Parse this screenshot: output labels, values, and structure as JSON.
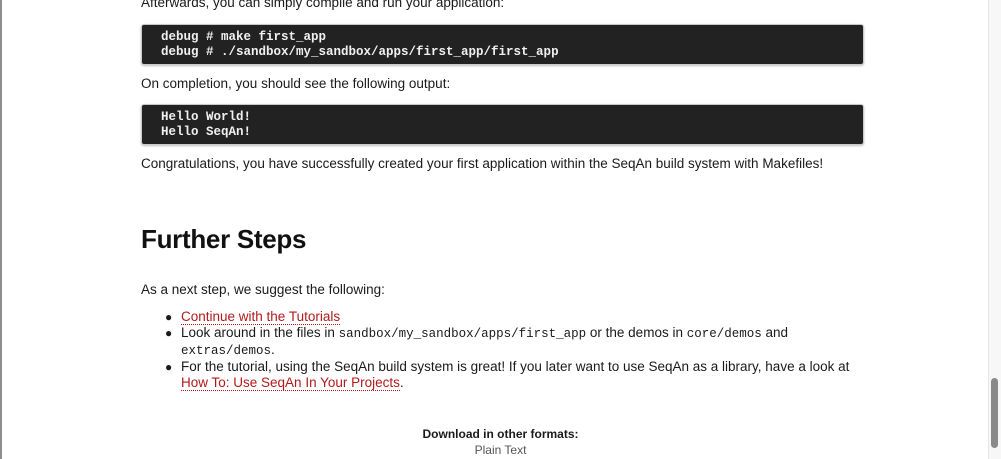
{
  "intro_text": "Afterwards, you can simply compile and run your application:",
  "code_build": {
    "lines": [
      "debug # make first_app",
      "debug # ./sandbox/my_sandbox/apps/first_app/first_app"
    ]
  },
  "completion_text": "On completion, you should see the following output:",
  "code_output": {
    "lines": [
      "Hello World!",
      "Hello SeqAn!"
    ]
  },
  "congrats_text": "Congratulations, you have successfully created your first application within the SeqAn build system with Makefiles!",
  "further_steps": {
    "heading": "Further Steps",
    "intro": "As a next step, we suggest the following:",
    "item1_link": "Continue with the Tutorials",
    "item2": {
      "part1": "Look around in the files in ",
      "code1": "sandbox/my_sandbox/apps/first_app",
      "part2": " or the demos in ",
      "code2": "core/demos",
      "part3": " and ",
      "code3": "extras/demos",
      "part4": "."
    },
    "item3": {
      "part1": "For the tutorial, using the SeqAn build system is great! If you later want to use SeqAn as a library, have a look at ",
      "link": "How To: Use SeqAn In Your Projects",
      "part2": "."
    }
  },
  "downloads": {
    "title": "Download in other formats:",
    "plain_text": "Plain Text"
  },
  "colors": {
    "link": "#b11a1a",
    "code_bg": "#222222"
  }
}
